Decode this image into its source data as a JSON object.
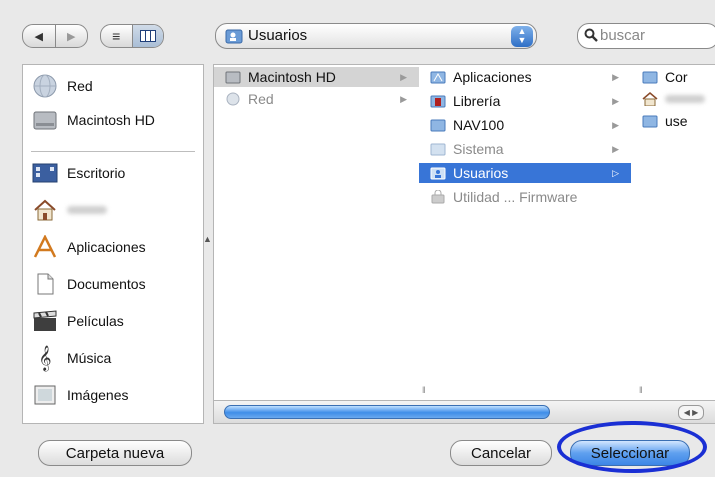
{
  "toolbar": {
    "back_icon": "back-arrow-icon",
    "forward_icon": "forward-arrow-icon",
    "list_view_icon": "list-view-icon",
    "column_view_icon": "column-view-icon",
    "location": "Usuarios",
    "search_placeholder": "buscar"
  },
  "sidebar": {
    "devices": [
      {
        "label": "Red",
        "icon": "network-globe-icon"
      },
      {
        "label": "Macintosh HD",
        "icon": "hard-drive-icon"
      }
    ],
    "places": [
      {
        "label": "Escritorio",
        "icon": "desktop-icon"
      },
      {
        "label": "",
        "icon": "home-icon"
      },
      {
        "label": "Aplicaciones",
        "icon": "applications-icon"
      },
      {
        "label": "Documentos",
        "icon": "documents-icon"
      },
      {
        "label": "Películas",
        "icon": "movies-icon"
      },
      {
        "label": "Música",
        "icon": "music-icon"
      },
      {
        "label": "Imágenes",
        "icon": "pictures-icon"
      }
    ]
  },
  "columns": [
    {
      "items": [
        {
          "label": "Macintosh HD",
          "state": "parent"
        },
        {
          "label": "Red",
          "state": "dim"
        }
      ]
    },
    {
      "items": [
        {
          "label": "Aplicaciones",
          "state": "normal"
        },
        {
          "label": "Librería",
          "state": "normal"
        },
        {
          "label": "NAV100",
          "state": "normal"
        },
        {
          "label": "Sistema",
          "state": "dim"
        },
        {
          "label": "Usuarios",
          "state": "selected"
        },
        {
          "label": "Utilidad ... Firmware",
          "state": "dim"
        }
      ]
    },
    {
      "items": [
        {
          "label": "Cor",
          "state": "normal"
        },
        {
          "label": "",
          "state": "normal"
        },
        {
          "label": "use",
          "state": "normal"
        }
      ]
    }
  ],
  "buttons": {
    "new_folder": "Carpeta nueva",
    "cancel": "Cancelar",
    "select": "Seleccionar"
  },
  "colors": {
    "selection": "#3875d7",
    "annotation": "#1a2fd4"
  }
}
